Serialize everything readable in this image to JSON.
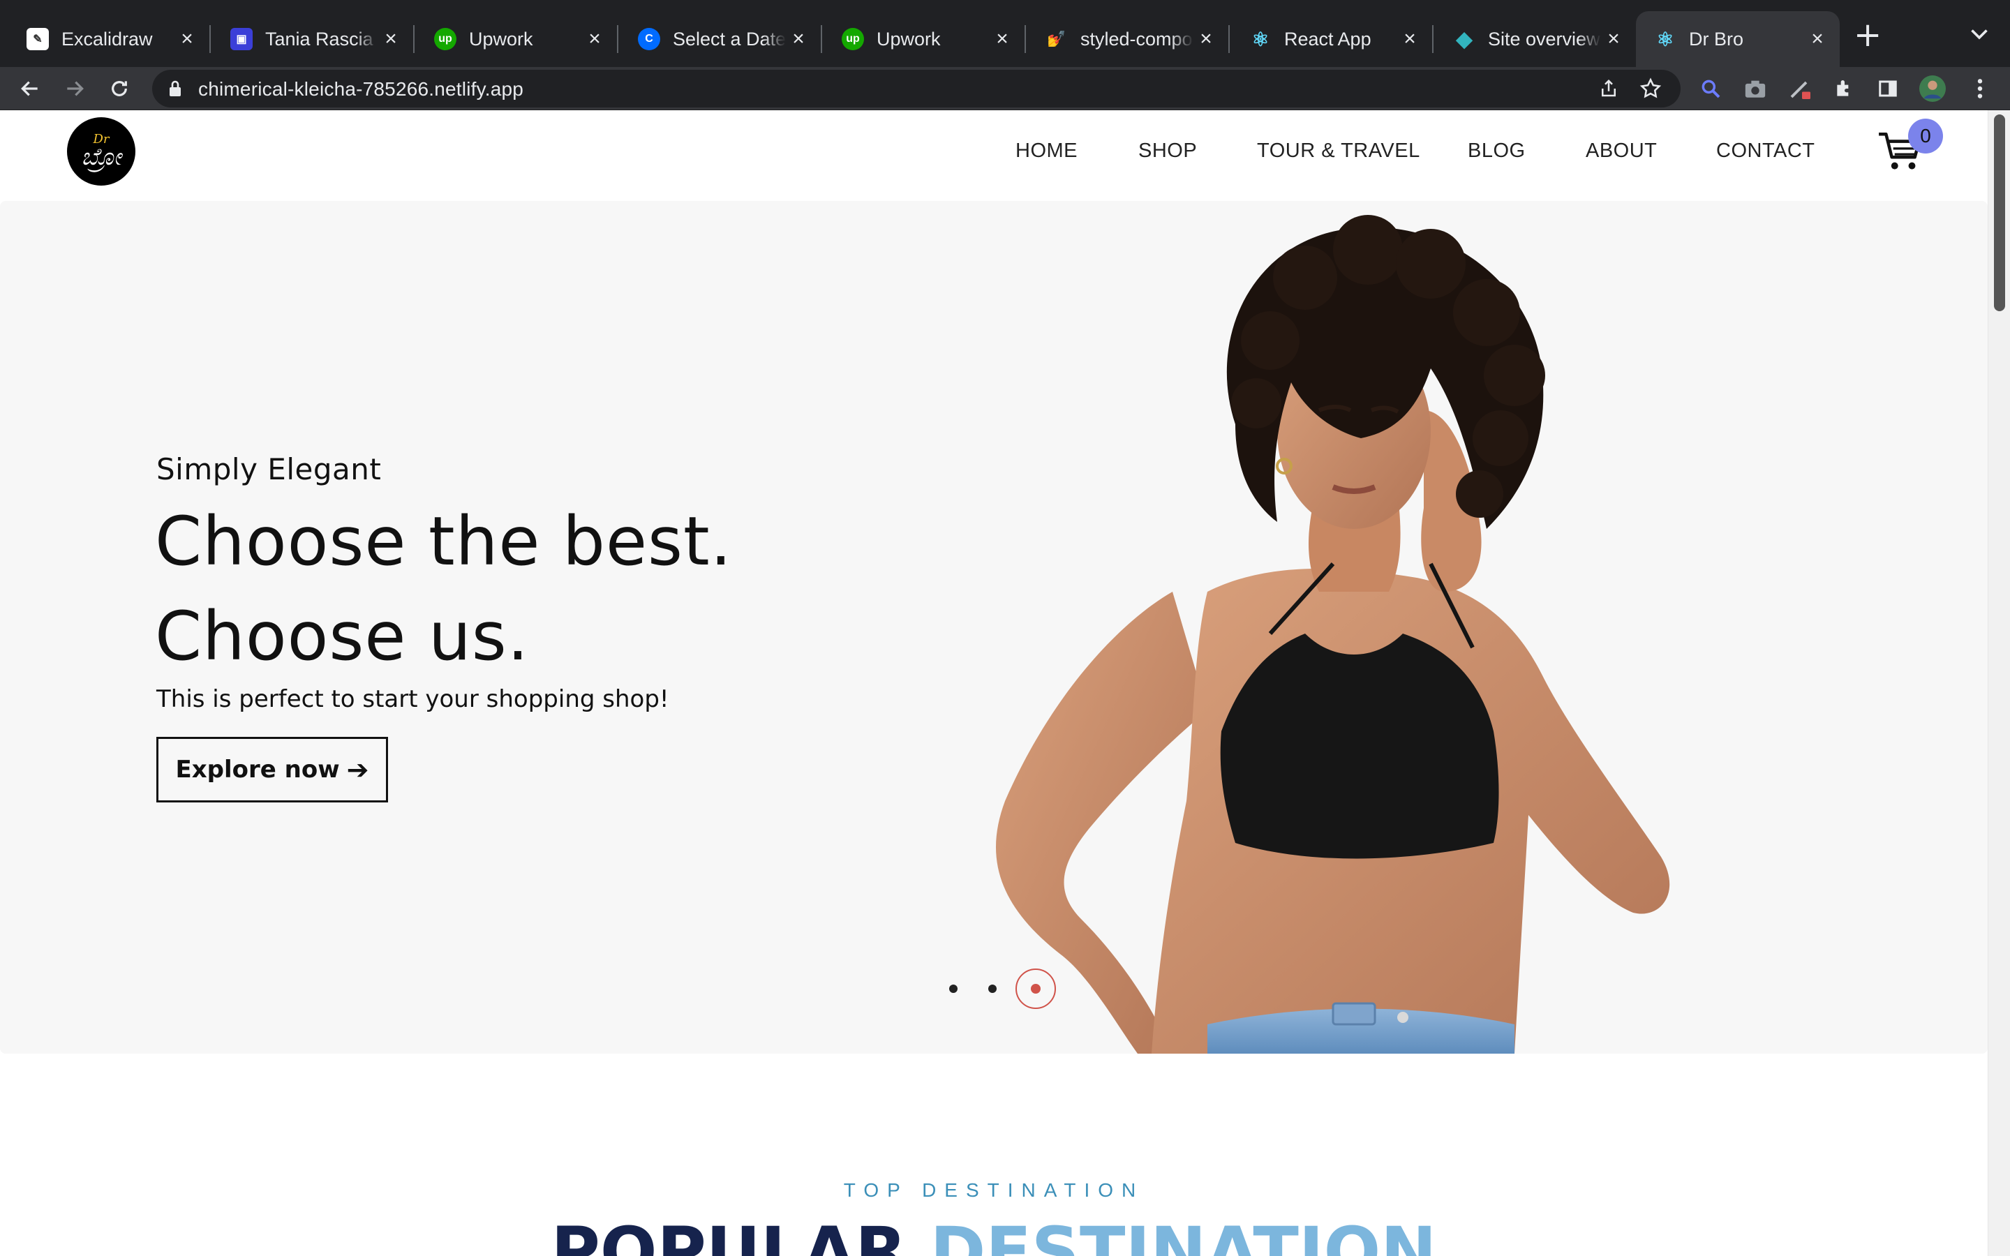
{
  "browser": {
    "tabs": [
      {
        "title": "Excalidraw",
        "icon": "excalidraw-icon"
      },
      {
        "title": "Tania Rascia",
        "icon": "floppy-disk-icon"
      },
      {
        "title": "Upwork",
        "icon": "upwork-icon"
      },
      {
        "title": "Select a Date & Time",
        "icon": "calendly-icon"
      },
      {
        "title": "Upwork",
        "icon": "upwork-icon"
      },
      {
        "title": "styled-components",
        "icon": "styled-components-icon"
      },
      {
        "title": "React App",
        "icon": "react-icon"
      },
      {
        "title": "Site overview",
        "icon": "netlify-icon"
      },
      {
        "title": "Dr Bro",
        "icon": "react-icon",
        "active": true
      }
    ],
    "new_tab_label": "+",
    "url": "chimerical-kleicha-785266.netlify.app"
  },
  "site": {
    "logo": {
      "line1": "Dr",
      "line2": "ಬ್ರೋ"
    },
    "nav": [
      "HOME",
      "SHOP",
      "TOUR & TRAVEL",
      "BLOG",
      "ABOUT",
      "CONTACT"
    ],
    "cart_count": "0"
  },
  "hero": {
    "kicker": "Simply Elegant",
    "headline_line1": "Choose the best.",
    "headline_line2": "Choose us.",
    "subtitle": "This is perfect to start your shopping shop!",
    "cta_label": "Explore now",
    "cta_arrow": "➔",
    "slides_total": 3,
    "active_slide": 3
  },
  "section": {
    "kicker": "TOP DESTINATION",
    "title_part1": "POPULAR ",
    "title_part2": "DESTINATION"
  },
  "colors": {
    "badge": "#7b83eb",
    "active_dot": "#d0534a",
    "title_dark": "#16234d",
    "title_light": "#7cb6dd",
    "kicker_blue": "#3b8fb8"
  }
}
